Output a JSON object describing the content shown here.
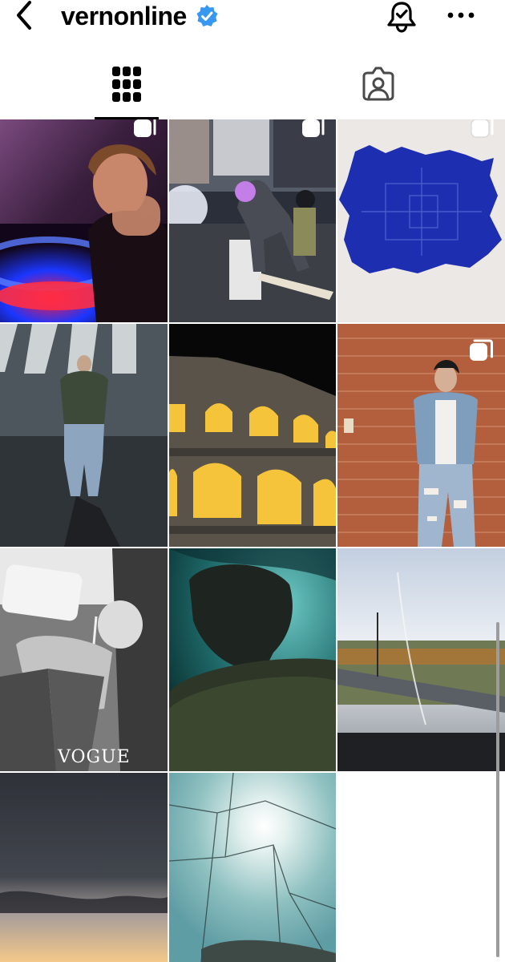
{
  "header": {
    "username": "vernonline",
    "back_icon": "chevron-left-icon",
    "verified_icon": "verified-badge-icon",
    "notification_icon": "bell-check-icon",
    "more_icon": "more-horizontal-icon"
  },
  "tabs": [
    {
      "name": "posts-grid",
      "icon": "grid-icon",
      "selected": true
    },
    {
      "name": "tagged",
      "icon": "tagged-portrait-icon",
      "selected": false
    }
  ],
  "posts": [
    {
      "subject": "neon-lit room portrait",
      "multi": true
    },
    {
      "subject": "skateboarder street night",
      "multi": true
    },
    {
      "subject": "blue fur rug on wall",
      "multi": true
    },
    {
      "subject": "crosswalk fashion shot",
      "multi": false
    },
    {
      "subject": "colosseum at night",
      "multi": false
    },
    {
      "subject": "denim outfit brick wall",
      "multi": true
    },
    {
      "subject": "black and white magazine shoot",
      "multi": false
    },
    {
      "subject": "underwater silhouette",
      "multi": false
    },
    {
      "subject": "train window landscape",
      "multi": false
    },
    {
      "subject": "dusk clouds",
      "multi": false
    },
    {
      "subject": "cracked glass sun",
      "multi": false
    }
  ],
  "magazine_text": "VOGUE",
  "colors": {
    "accent_blue": "#3897f0",
    "divider": "#ffffff"
  }
}
